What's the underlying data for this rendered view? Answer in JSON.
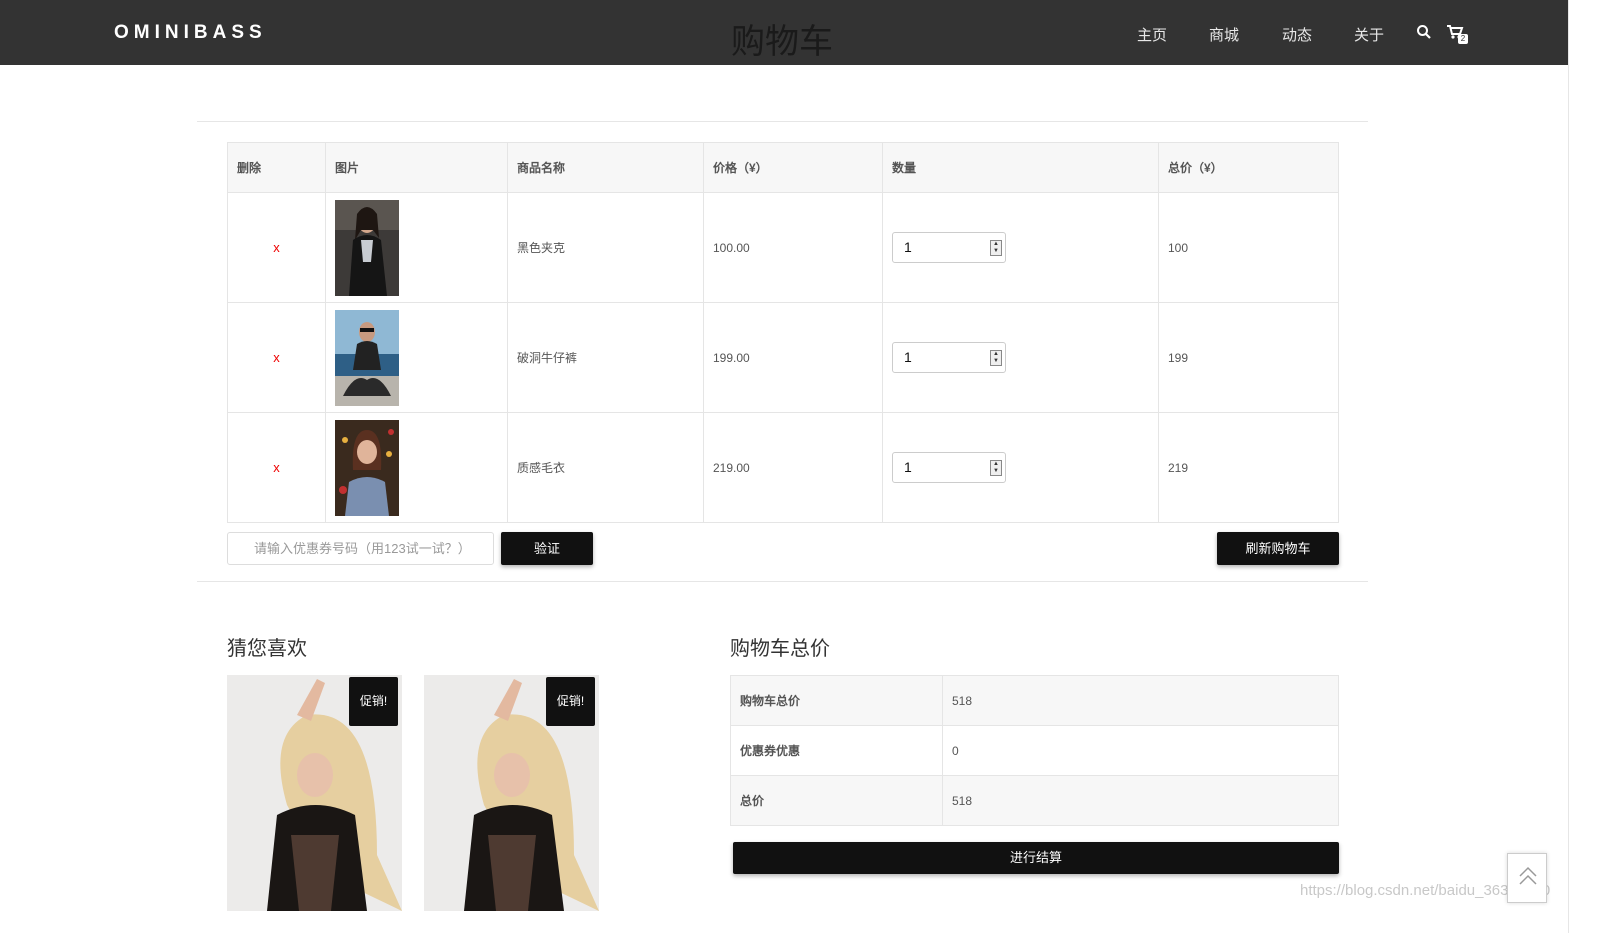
{
  "header": {
    "brand": "OMINIBASS",
    "title": "购物车",
    "nav": [
      "主页",
      "商城",
      "动态",
      "关于"
    ],
    "cart_count": "2"
  },
  "cart_table": {
    "headers": [
      "删除",
      "图片",
      "商品名称",
      "价格（¥）",
      "数量",
      "总价（¥）"
    ],
    "rows": [
      {
        "remove": "x",
        "name": "黑色夹克",
        "price": "100.00",
        "qty": "1",
        "total": "100"
      },
      {
        "remove": "x",
        "name": "破洞牛仔裤",
        "price": "199.00",
        "qty": "1",
        "total": "199"
      },
      {
        "remove": "x",
        "name": "质感毛衣",
        "price": "219.00",
        "qty": "1",
        "total": "219"
      }
    ]
  },
  "coupon": {
    "placeholder": "请输入优惠券号码（用123试一试？）",
    "verify_label": "验证",
    "refresh_label": "刷新购物车"
  },
  "recommend": {
    "title": "猜您喜欢",
    "items": [
      {
        "badge": "促销!"
      },
      {
        "badge": "促销!"
      }
    ]
  },
  "summary": {
    "title": "购物车总价",
    "rows": [
      {
        "label": "购物车总价",
        "value": "518"
      },
      {
        "label": "优惠券优惠",
        "value": "0"
      },
      {
        "label": "总价",
        "value": "518"
      }
    ],
    "checkout_label": "进行结算"
  },
  "watermark": "https://blog.csdn.net/baidu_36369980",
  "colors": {
    "header_bg": "#333333",
    "button_bg": "#111111",
    "remove": "#ee0000"
  }
}
